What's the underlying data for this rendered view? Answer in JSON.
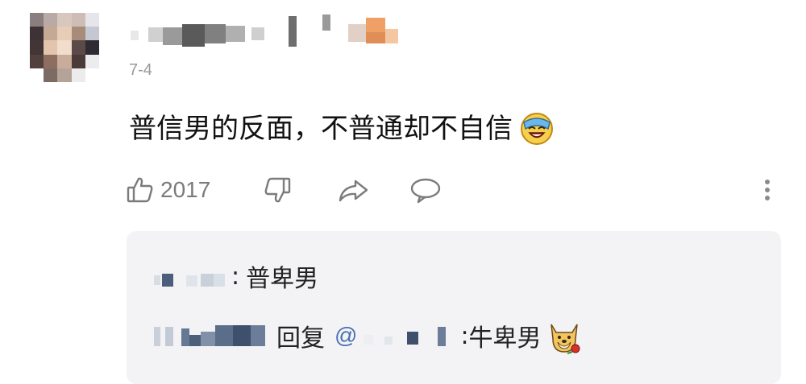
{
  "comment": {
    "date": "7-4",
    "text": "普信男的反面，不普通却不自信",
    "emoji_icon": "laughing-crying-face-icon",
    "like_count": "2017"
  },
  "actions": {
    "like_icon": "thumbs-up-icon",
    "dislike_icon": "thumbs-down-icon",
    "share_icon": "share-arrow-icon",
    "comment_icon": "speech-bubble-icon",
    "more_icon": "vertical-dots-icon"
  },
  "replies": [
    {
      "separator": ":",
      "text": "普卑男"
    },
    {
      "reply_word": "回复",
      "at_sign": "@",
      "separator": ":",
      "text": "牛卑男",
      "emoji_icon": "doge-with-rose-icon"
    }
  ],
  "colors": {
    "mention": "#4a6fb5",
    "reply_bg": "#f3f3f5",
    "muted": "#9a9a9a"
  }
}
